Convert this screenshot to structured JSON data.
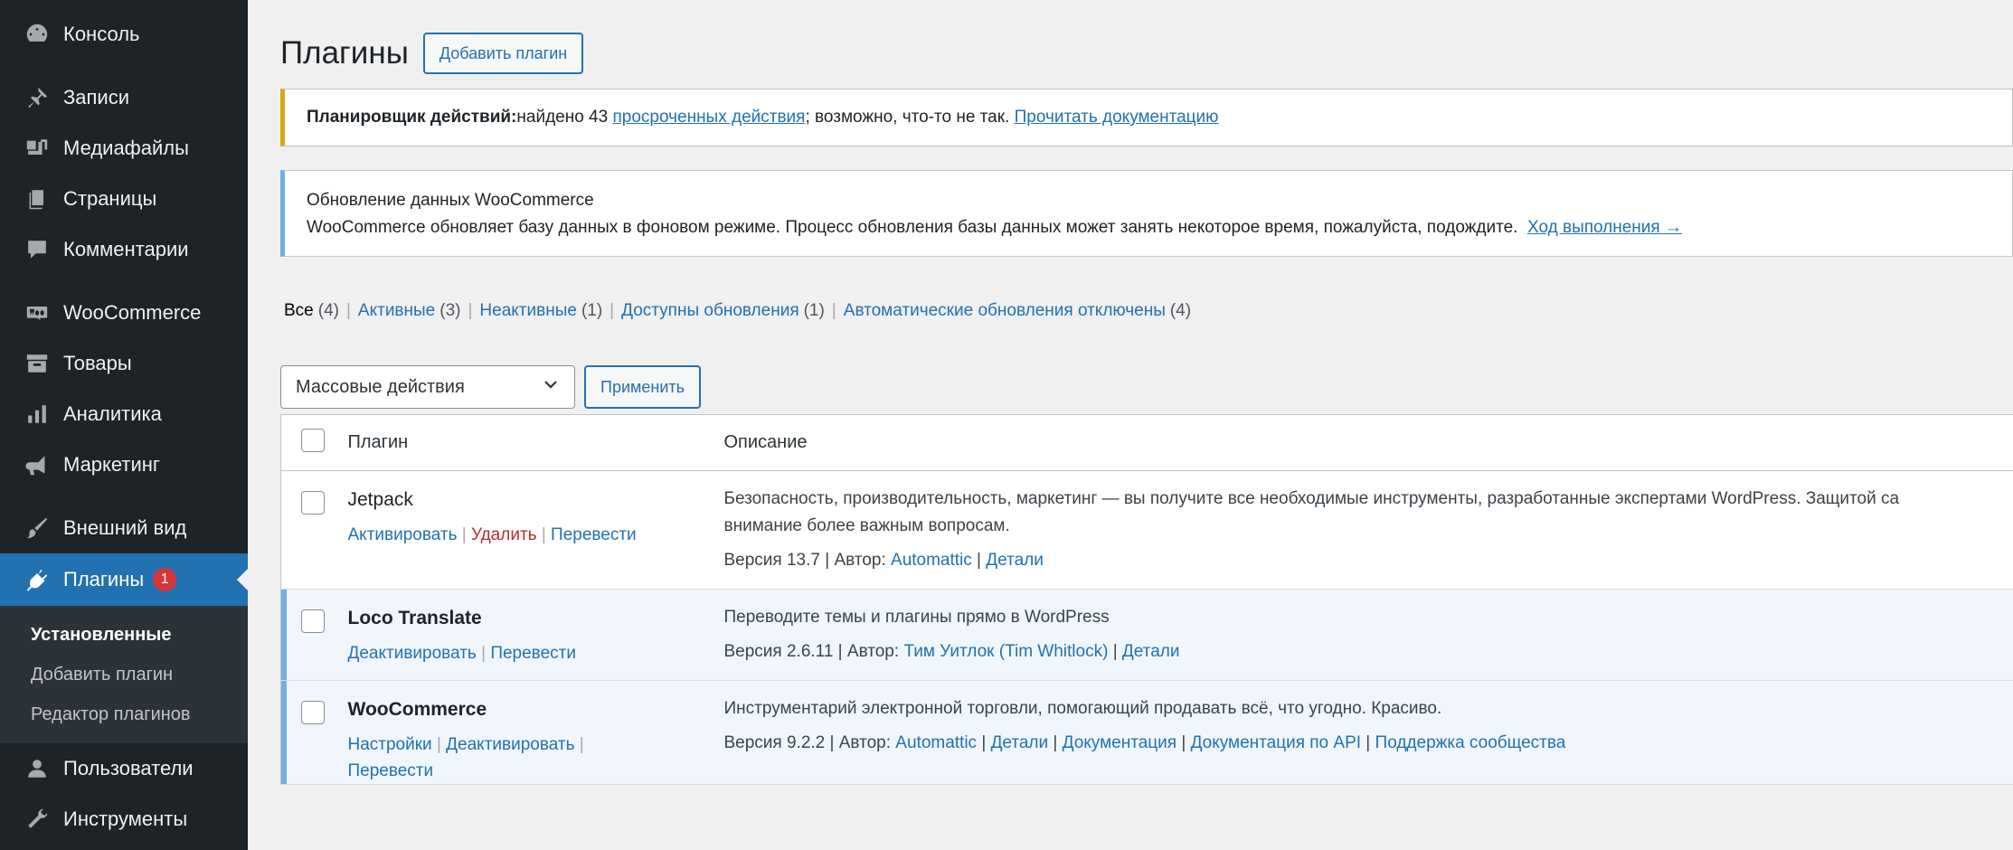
{
  "sidebar": {
    "items": [
      {
        "label": "Консоль",
        "icon": "dashboard-icon"
      },
      {
        "label": "Записи",
        "icon": "pin-icon"
      },
      {
        "label": "Медиафайлы",
        "icon": "media-icon"
      },
      {
        "label": "Страницы",
        "icon": "pages-icon"
      },
      {
        "label": "Комментарии",
        "icon": "comment-icon"
      },
      {
        "label": "WooCommerce",
        "icon": "woo-icon"
      },
      {
        "label": "Товары",
        "icon": "archive-icon"
      },
      {
        "label": "Аналитика",
        "icon": "chart-bar-icon"
      },
      {
        "label": "Маркетинг",
        "icon": "megaphone-icon"
      },
      {
        "label": "Внешний вид",
        "icon": "brush-icon"
      },
      {
        "label": "Плагины",
        "icon": "plugin-icon",
        "badge": "1"
      },
      {
        "label": "Пользователи",
        "icon": "users-icon"
      },
      {
        "label": "Инструменты",
        "icon": "wrench-icon"
      }
    ],
    "submenu": [
      "Установленные",
      "Добавить плагин",
      "Редактор плагинов"
    ]
  },
  "header": {
    "title": "Плагины",
    "add_button": "Добавить плагин"
  },
  "notice_warning": {
    "strong": "Планировщик действий:",
    "text1": "найдено 43 ",
    "link1": "просроченных действия",
    "text2": "; возможно, что-то не так. ",
    "link2": "Прочитать документацию"
  },
  "notice_info": {
    "title": "Обновление данных WooCommerce",
    "text": "WooCommerce обновляет базу данных в фоновом режиме. Процесс обновления базы данных может занять некоторое время, пожалуйста, подождите.",
    "link": "Ход выполнения →"
  },
  "filters": [
    {
      "label": "Все",
      "count": "(4)"
    },
    {
      "label": "Активные",
      "count": "(3)"
    },
    {
      "label": "Неактивные",
      "count": "(1)"
    },
    {
      "label": "Доступны обновления",
      "count": "(1)"
    },
    {
      "label": "Автоматические обновления отключены",
      "count": "(4)"
    }
  ],
  "bulk": {
    "select_value": "Массовые действия",
    "apply": "Применить"
  },
  "table": {
    "col_plugin": "Плагин",
    "col_description": "Описание",
    "rows": [
      {
        "name": "Jetpack",
        "actions": [
          "Активировать",
          "Удалить",
          "Перевести"
        ],
        "desc1": "Безопасность, производительность, маркетинг — вы получите все необходимые инструменты, разработанные экспертами WordPress. Защитой са",
        "desc2": "внимание более важным вопросам.",
        "version": "Версия 13.7",
        "author_label": "Автор:",
        "author": "Automattic",
        "links": [
          "Детали"
        ]
      },
      {
        "name": "Loco Translate",
        "actions": [
          "Деактивировать",
          "Перевести"
        ],
        "desc1": "Переводите темы и плагины прямо в WordPress",
        "version": "Версия 2.6.11",
        "author_label": "Автор:",
        "author": "Тим Уитлок (Tim Whitlock)",
        "links": [
          "Детали"
        ]
      },
      {
        "name": "WooCommerce",
        "actions": [
          "Настройки",
          "Деактивировать",
          "Перевести"
        ],
        "desc1": "Инструментарий электронной торговли, помогающий продавать всё, что угодно. Красиво.",
        "version": "Версия 9.2.2",
        "author_label": "Автор:",
        "author": "Automattic",
        "links": [
          "Детали",
          "Документация",
          "Документация по API",
          "Поддержка сообщества"
        ]
      }
    ]
  }
}
